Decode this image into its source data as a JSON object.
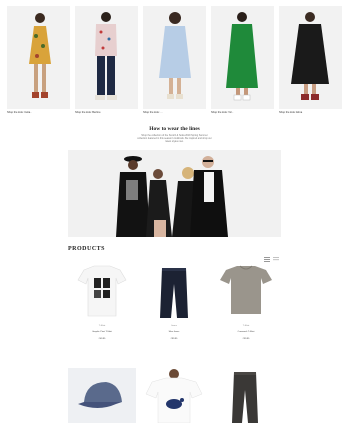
{
  "looks": [
    {
      "caption": "Shop the look: Celia..",
      "colors": {
        "dress": "#d9a33a",
        "accent": "#4a6b2a",
        "shoes": "#a3442d"
      }
    },
    {
      "caption": "Shop the look: Bertine",
      "colors": {
        "top": "#e7cfcf",
        "pants": "#1f2a44",
        "shoes": "#e8e3da"
      }
    },
    {
      "caption": "Shop the look: ...",
      "colors": {
        "dress": "#b7cde6",
        "shoes": "#e8e0d0"
      }
    },
    {
      "caption": "Shop the look: Vic..",
      "colors": {
        "dress": "#1f8a3a",
        "shoes": "#ffffff"
      }
    },
    {
      "caption": "Shop the look: Elma",
      "colors": {
        "dress": "#1a1a1a",
        "shoes": "#8c2b2b"
      }
    }
  ],
  "section": {
    "title": "How to wear the lines",
    "body": "Shop the collection of the Scotch & Soda 2019 Spring Summer collection featured in this season's lookbook. Be inspired and shop our latest styles now."
  },
  "products_heading": "PRODUCTS",
  "products": [
    {
      "category": "T-Shirt",
      "name": "Graphic Print T-Shirt",
      "price": "€49.95"
    },
    {
      "category": "Jeans",
      "name": "Slim Jeans",
      "price": "€99.95"
    },
    {
      "category": "T-Shirt",
      "name": "Crewneck T-Shirt",
      "price": "€39.95"
    }
  ],
  "icons": {
    "grid_toggle": "grid-view-icon",
    "list_toggle": "list-view-icon"
  }
}
